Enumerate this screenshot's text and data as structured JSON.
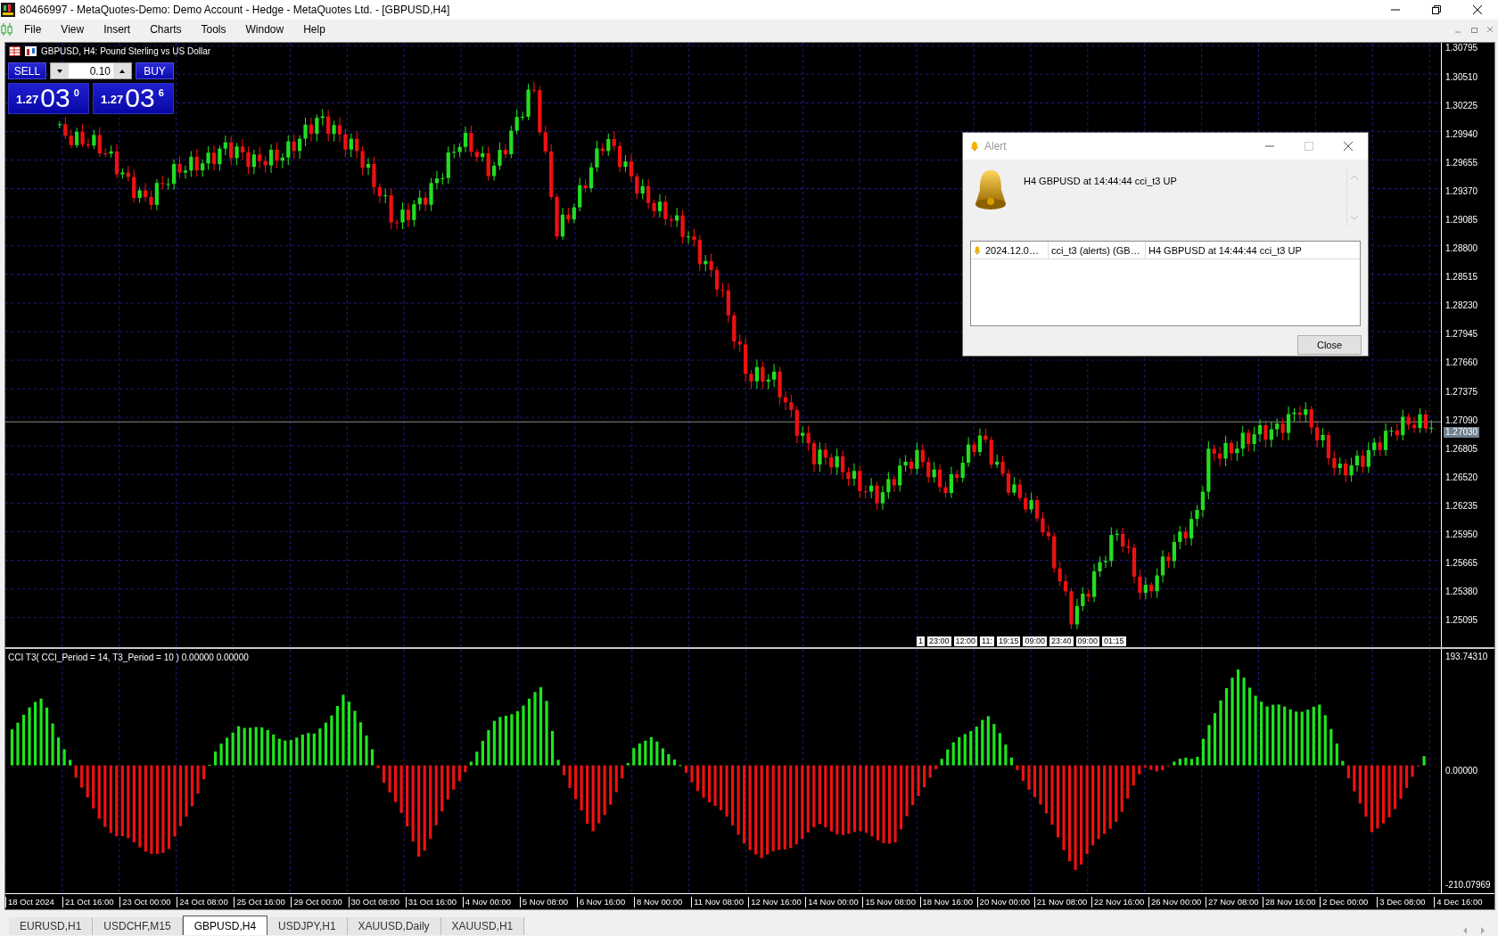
{
  "window": {
    "title": "80466997 - MetaQuotes-Demo: Demo Account - Hedge - MetaQuotes Ltd. - [GBPUSD,H4]"
  },
  "menu": [
    "File",
    "View",
    "Insert",
    "Charts",
    "Tools",
    "Window",
    "Help"
  ],
  "chart": {
    "header": "GBPUSD, H4:  Pound Sterling vs US Dollar",
    "trade_panel": {
      "sell": "SELL",
      "buy": "BUY",
      "volume": "0.10",
      "bid": {
        "prefix": "1.27",
        "pips": "03",
        "point": "0"
      },
      "ask": {
        "prefix": "1.27",
        "pips": "03",
        "point": "6"
      }
    },
    "price_axis": [
      "1.30795",
      "1.30510",
      "1.30225",
      "1.29940",
      "1.29655",
      "1.29370",
      "1.29085",
      "1.28800",
      "1.28515",
      "1.28230",
      "1.27945",
      "1.27660",
      "1.27375",
      "1.27090",
      "1.26805",
      "1.26520",
      "1.26235",
      "1.25950",
      "1.25665",
      "1.25380",
      "1.25095"
    ],
    "current_price": "1.27030",
    "time_markers": [
      "1",
      "23:00",
      "12:00",
      "11:",
      "19:15",
      "09:00",
      "23:40",
      "09:00",
      "01:15"
    ],
    "indicator": {
      "label": "CCI T3( CCI_Period = 14, T3_Period = 10 ) 0.00000 0.00000",
      "axis": [
        "193.74310",
        "0.00000",
        "-210.07969"
      ]
    },
    "time_axis": [
      "18 Oct 2024",
      "21 Oct 16:00",
      "23 Oct 00:00",
      "24 Oct 08:00",
      "25 Oct 16:00",
      "29 Oct 00:00",
      "30 Oct 08:00",
      "31 Oct 16:00",
      "4 Nov 00:00",
      "5 Nov 08:00",
      "6 Nov 16:00",
      "8 Nov 00:00",
      "11 Nov 08:00",
      "12 Nov 16:00",
      "14 Nov 00:00",
      "15 Nov 08:00",
      "18 Nov 16:00",
      "20 Nov 00:00",
      "21 Nov 08:00",
      "22 Nov 16:00",
      "26 Nov 00:00",
      "27 Nov 08:00",
      "28 Nov 16:00",
      "2 Dec 00:00",
      "3 Dec 08:00",
      "4 Dec 16:00"
    ]
  },
  "alert": {
    "title": "Alert",
    "message": "H4 GBPUSD at 14:44:44 cci_t3 UP",
    "log": [
      {
        "time": "2024.12.0…",
        "source": "cci_t3 (alerts) (GB…",
        "message": "H4 GBPUSD at 14:44:44 cci_t3 UP"
      }
    ],
    "close": "Close"
  },
  "tabs": [
    {
      "label": "EURUSD,H1",
      "selected": false
    },
    {
      "label": "USDCHF,M15",
      "selected": false
    },
    {
      "label": "GBPUSD,H4",
      "selected": true
    },
    {
      "label": "USDJPY,H1",
      "selected": false
    },
    {
      "label": "XAUUSD,Daily",
      "selected": false
    },
    {
      "label": "XAUUSD,H1",
      "selected": false
    }
  ]
}
